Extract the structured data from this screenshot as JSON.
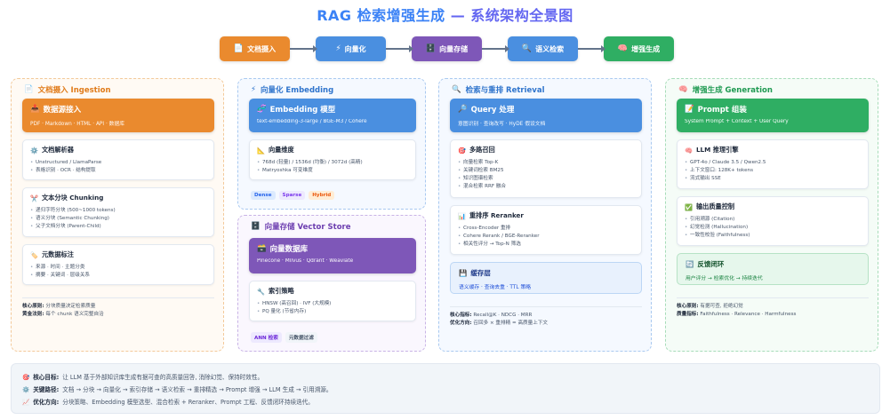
{
  "title": {
    "part1": "RAG 检索增强生成",
    "part2": "— 系统架构全景图"
  },
  "flow": [
    {
      "icon": "📄",
      "label": "文档摄入",
      "color": "#ea8a2e"
    },
    {
      "icon": "⚡",
      "label": "向量化",
      "color": "#4a8fe0"
    },
    {
      "icon": "🗄️",
      "label": "向量存储",
      "color": "#7e57b8"
    },
    {
      "icon": "🔍",
      "label": "语义检索",
      "color": "#4a8fe0"
    },
    {
      "icon": "🧠",
      "label": "增强生成",
      "color": "#2fae63"
    }
  ],
  "ingestion": {
    "title": "文档摄入 Ingestion",
    "icon": "📄",
    "header": {
      "icon": "📥",
      "title": "数据源接入",
      "sub": "PDF · Markdown · HTML · API · 数据库"
    },
    "cards": [
      {
        "icon": "⚙️",
        "title": "文档解析器",
        "items": [
          "Unstructured / LlamaParse",
          "表格识别 · OCR · 结构提取"
        ]
      },
      {
        "icon": "✂️",
        "title": "文本分块 Chunking",
        "items": [
          "递归字符分块 (500~1000 tokens)",
          "语义分块 (Semantic Chunking)",
          "父子文档分块 (Parent-Child)"
        ]
      },
      {
        "icon": "🏷️",
        "title": "元数据标注",
        "items": [
          "来源 · 时间 · 主题分类",
          "摘要 · 关键词 · 层级关系"
        ]
      }
    ],
    "notes": [
      {
        "label": "核心原则:",
        "text": "分块质量决定检索质量"
      },
      {
        "label": "黄金法则:",
        "text": "每个 chunk 语义完整自洽"
      }
    ]
  },
  "embedding": {
    "title": "向量化 Embedding",
    "icon": "⚡",
    "header": {
      "icon": "🧬",
      "title": "Embedding 模型",
      "sub": "text-embedding-3-large / BGE-M3 / Cohere"
    },
    "card": {
      "icon": "📐",
      "title": "向量维度",
      "items": [
        "768d (轻量) / 1536d (均衡) / 3072d (高精)",
        "Matryoshka 可变维度"
      ]
    },
    "tags": [
      "Dense",
      "Sparse",
      "Hybrid"
    ]
  },
  "store": {
    "title": "向量存储 Vector Store",
    "icon": "🗄️",
    "header": {
      "icon": "🗃️",
      "title": "向量数据库",
      "sub": "Pinecone · Milvus · Qdrant · Weaviate"
    },
    "card": {
      "icon": "🔧",
      "title": "索引策略",
      "items": [
        "HNSW (高召回) · IVF (大规模)",
        "PQ 量化 (节省内存)"
      ]
    },
    "tags": [
      "ANN 检索",
      "元数据过滤"
    ]
  },
  "retrieval": {
    "title": "检索与重排 Retrieval",
    "icon": "🔍",
    "header": {
      "icon": "🔎",
      "title": "Query 处理",
      "sub": "意图识别 · 查询改写 · HyDE 假设文档"
    },
    "cards": [
      {
        "icon": "🎯",
        "title": "多路召回",
        "items": [
          "向量检索 Top-K",
          "关键词检索 BM25",
          "知识图谱检索",
          "混合检索 RRF 融合"
        ]
      },
      {
        "icon": "📊",
        "title": "重排序 Reranker",
        "items": [
          "Cross-Encoder 重排",
          "Cohere Rerank / BGE-Reranker",
          "相关性评分 → Top-N 筛选"
        ]
      }
    ],
    "cache": {
      "icon": "💾",
      "title": "缓存层",
      "sub": "语义缓存 · 查询去重 · TTL 策略"
    },
    "notes": [
      {
        "label": "核心指标:",
        "text": "Recall@K · NDCG · MRR"
      },
      {
        "label": "优化方向:",
        "text": "召回多 × 重排精 = 高质量上下文"
      }
    ]
  },
  "generation": {
    "title": "增强生成 Generation",
    "icon": "🧠",
    "header": {
      "icon": "📝",
      "title": "Prompt 组装",
      "sub": "System Prompt + Context + User Query"
    },
    "cards": [
      {
        "icon": "🧠",
        "title": "LLM 推理引擎",
        "items": [
          "GPT-4o / Claude 3.5 / Qwen2.5",
          "上下文窗口: 128K+ tokens",
          "流式输出 SSE"
        ]
      },
      {
        "icon": "✅",
        "title": "输出质量控制",
        "items": [
          "引用溯源 (Citation)",
          "幻觉检测 (Hallucination)",
          "一致性校验 (Faithfulness)"
        ]
      }
    ],
    "feedback": {
      "icon": "🔄",
      "title": "反馈闭环",
      "sub": "用户评分 → 检索优化 → 持续迭代"
    },
    "notes": [
      {
        "label": "核心原则:",
        "text": "有据可查, 拒绝幻觉"
      },
      {
        "label": "质量指标:",
        "text": "Faithfulness · Relevance · Harmfulness"
      }
    ]
  },
  "summary": [
    {
      "icon": "🎯",
      "label": "核心目标:",
      "text": "让 LLM 基于外部知识库生成有据可查的高质量回答, 消除幻觉、保持时效性。"
    },
    {
      "icon": "⚙️",
      "label": "关键路径:",
      "text": "文档 → 分块 → 向量化 → 索引存储 → 语义检索 → 重排精选 → Prompt 增强 → LLM 生成 → 引用溯源。"
    },
    {
      "icon": "📈",
      "label": "优化方向:",
      "text": "分块策略、Embedding 模型选型、混合检索 + Reranker、Prompt 工程、反馈闭环持续迭代。"
    }
  ],
  "colors": {
    "orange": "#ea8a2e",
    "blue": "#4a8fe0",
    "purple": "#7e57b8",
    "green": "#2fae63"
  }
}
